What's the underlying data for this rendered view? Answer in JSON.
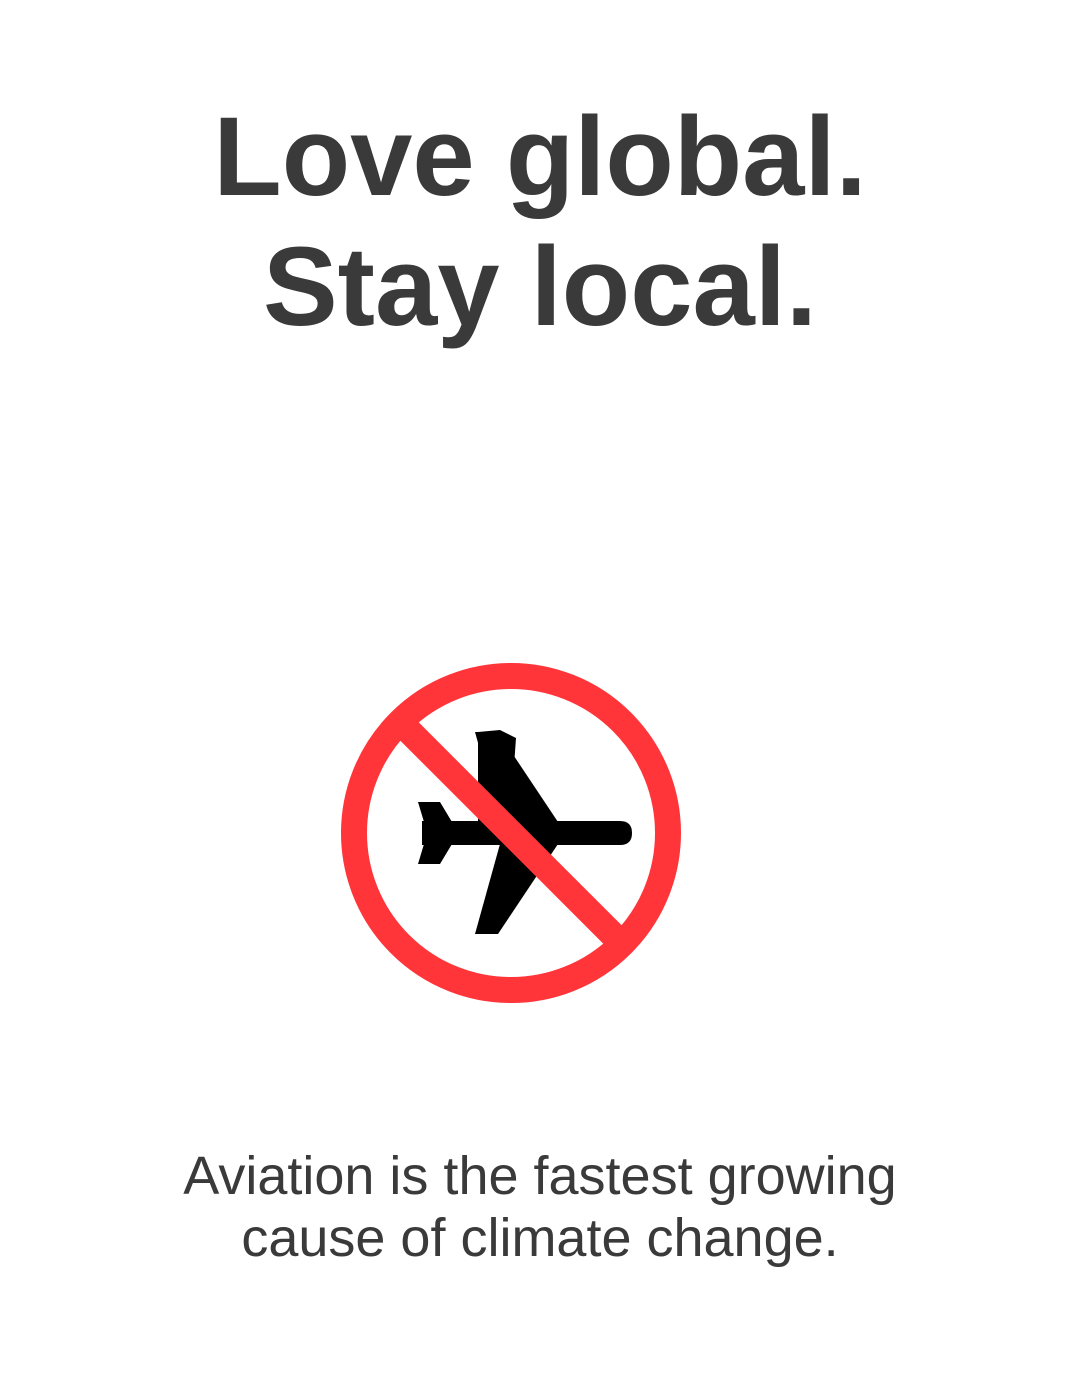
{
  "headline": {
    "line1": "Love global.",
    "line2": "Stay local."
  },
  "sign": {
    "icon": "no-flying-icon",
    "ring_color": "#ff353a",
    "plane_color": "#000000"
  },
  "caption": {
    "line1": "Aviation is the fastest growing",
    "line2": "cause of climate change."
  },
  "colors": {
    "text": "#3a3a3a",
    "background": "#ffffff"
  }
}
